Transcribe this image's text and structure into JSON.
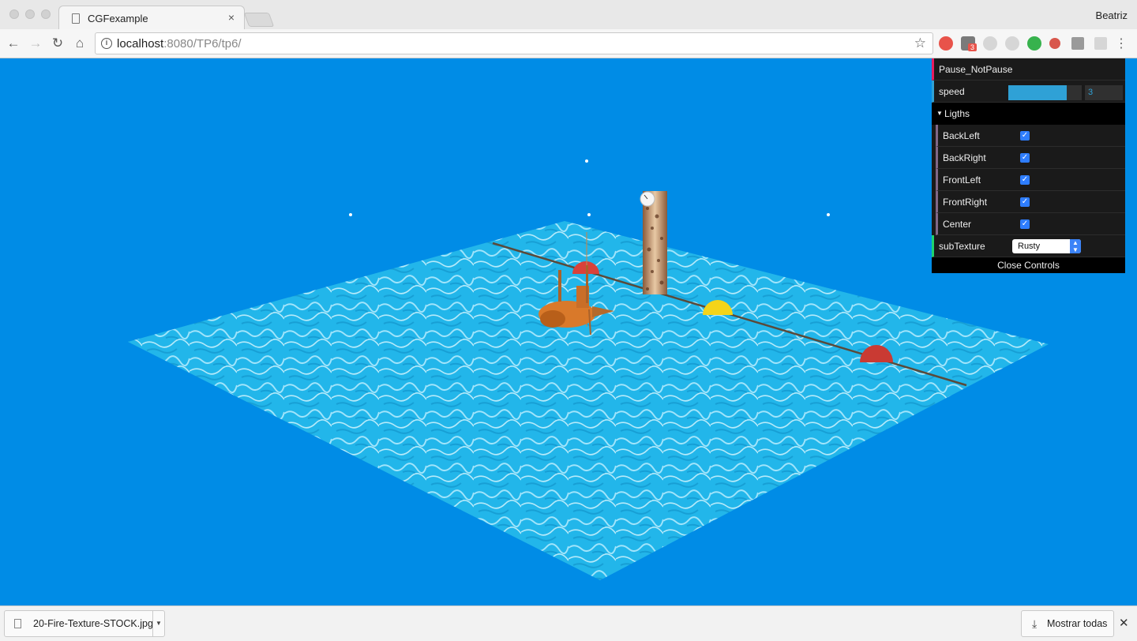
{
  "browser": {
    "tab_title": "CGFexample",
    "tab_close": "×",
    "user_name": "Beatriz",
    "url_host": "localhost",
    "url_rest": ":8080/TP6/tp6/",
    "ext_badge": "3",
    "icons": [
      "back-arrow-icon",
      "forward-arrow-icon",
      "reload-icon",
      "home-icon",
      "info-icon",
      "bookmark-star-icon",
      "menu-dots-icon"
    ]
  },
  "gui": {
    "pause_label": "Pause_NotPause",
    "speed_label": "speed",
    "speed_value": "3",
    "speed_fraction": 0.8,
    "lights_folder": "Ligths",
    "lights": [
      {
        "label": "BackLeft",
        "checked": true
      },
      {
        "label": "BackRight",
        "checked": true
      },
      {
        "label": "FrontLeft",
        "checked": true
      },
      {
        "label": "FrontRight",
        "checked": true
      },
      {
        "label": "Center",
        "checked": true
      }
    ],
    "subtexture_label": "subTexture",
    "subtexture_value": "Rusty",
    "close_label": "Close Controls",
    "check_glyph": "✓"
  },
  "downloads": {
    "file_name": "20-Fire-Texture-STOCK.jpg",
    "show_all": "Mostrar todas",
    "close": "✕"
  },
  "colors": {
    "scene_background": "#008ce6",
    "water": "#1fb3e8",
    "buoy_red": "#d9413a",
    "buoy_yellow": "#f4d419",
    "submarine": "#d9792a",
    "gui_function_accent": "#e61d5f",
    "gui_number_accent": "#2fa1d6"
  }
}
